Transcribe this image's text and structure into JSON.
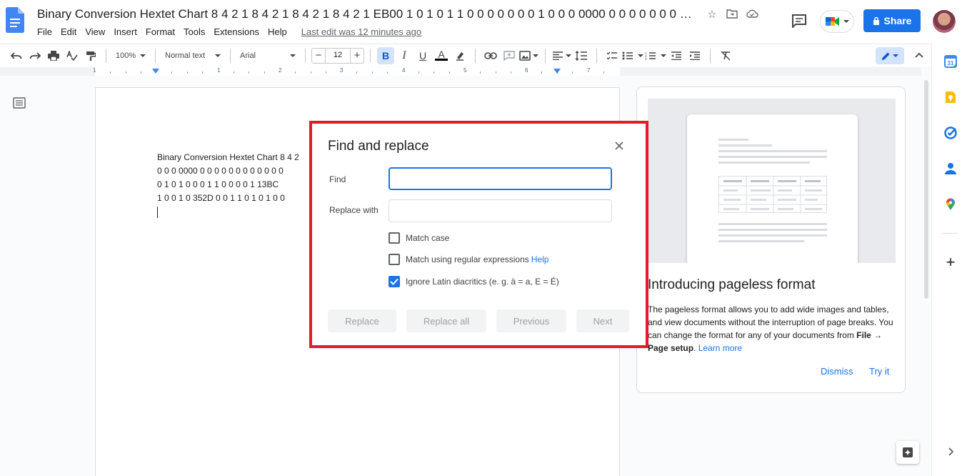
{
  "document": {
    "title": "Binary Conversion Hextet Chart 8 4 2 1 8 4 2 1 8 4 2 1 8 4 2 1 EB00 1 0 1 0 1 1 0 0 0 0 0 0 0 1 0 0 0 0000 0 0 0 0 0 0 0 0 0 0 0 0 0 0 ...",
    "body_lines": [
      "Binary Conversion Hextet Chart 8 4 2",
      "0 0 0 0000 0 0 0 0 0 0 0 0 0 0 0 0",
      "0 1 0 1 0 0 0 1 1 0 0  0 0 1 13BC",
      "1 0 0 1 0 352D 0 0 1 1 0 1 0 1 0 0"
    ]
  },
  "menu": {
    "items": [
      "File",
      "Edit",
      "View",
      "Insert",
      "Format",
      "Tools",
      "Extensions",
      "Help"
    ],
    "last_edit": "Last edit was 12 minutes ago"
  },
  "header": {
    "share_label": "Share"
  },
  "toolbar": {
    "zoom": "100%",
    "style": "Normal text",
    "font": "Arial",
    "font_size": "12",
    "bold": "B",
    "italic": "I",
    "underline": "U",
    "text_color": "A"
  },
  "ruler": {
    "numbers": [
      "1",
      "1",
      "2",
      "3",
      "4",
      "5",
      "6",
      "7"
    ]
  },
  "promo": {
    "title": "Introducing pageless format",
    "text_before": "The pageless format allows you to add wide images and tables, and view documents without the interruption of page breaks. You can change the format for any of your documents from ",
    "text_bold": "File → Page setup",
    "text_after": ". ",
    "learn_more": "Learn more",
    "dismiss": "Dismiss",
    "try_it": "Try it"
  },
  "dialog": {
    "title": "Find and replace",
    "find_label": "Find",
    "find_value": "",
    "replace_label": "Replace with",
    "replace_value": "",
    "options": [
      {
        "label": "Match case",
        "checked": false
      },
      {
        "label": "Match using regular expressions",
        "checked": false,
        "help": "Help"
      },
      {
        "label": "Ignore Latin diacritics (e. g. ä = a, E = É)",
        "checked": true
      }
    ],
    "buttons": {
      "replace": "Replace",
      "replace_all": "Replace all",
      "previous": "Previous",
      "next": "Next"
    }
  },
  "colors": {
    "accent": "#1a73e8",
    "highlight_frame": "#e21c26",
    "docs_blue": "#4285f4"
  }
}
